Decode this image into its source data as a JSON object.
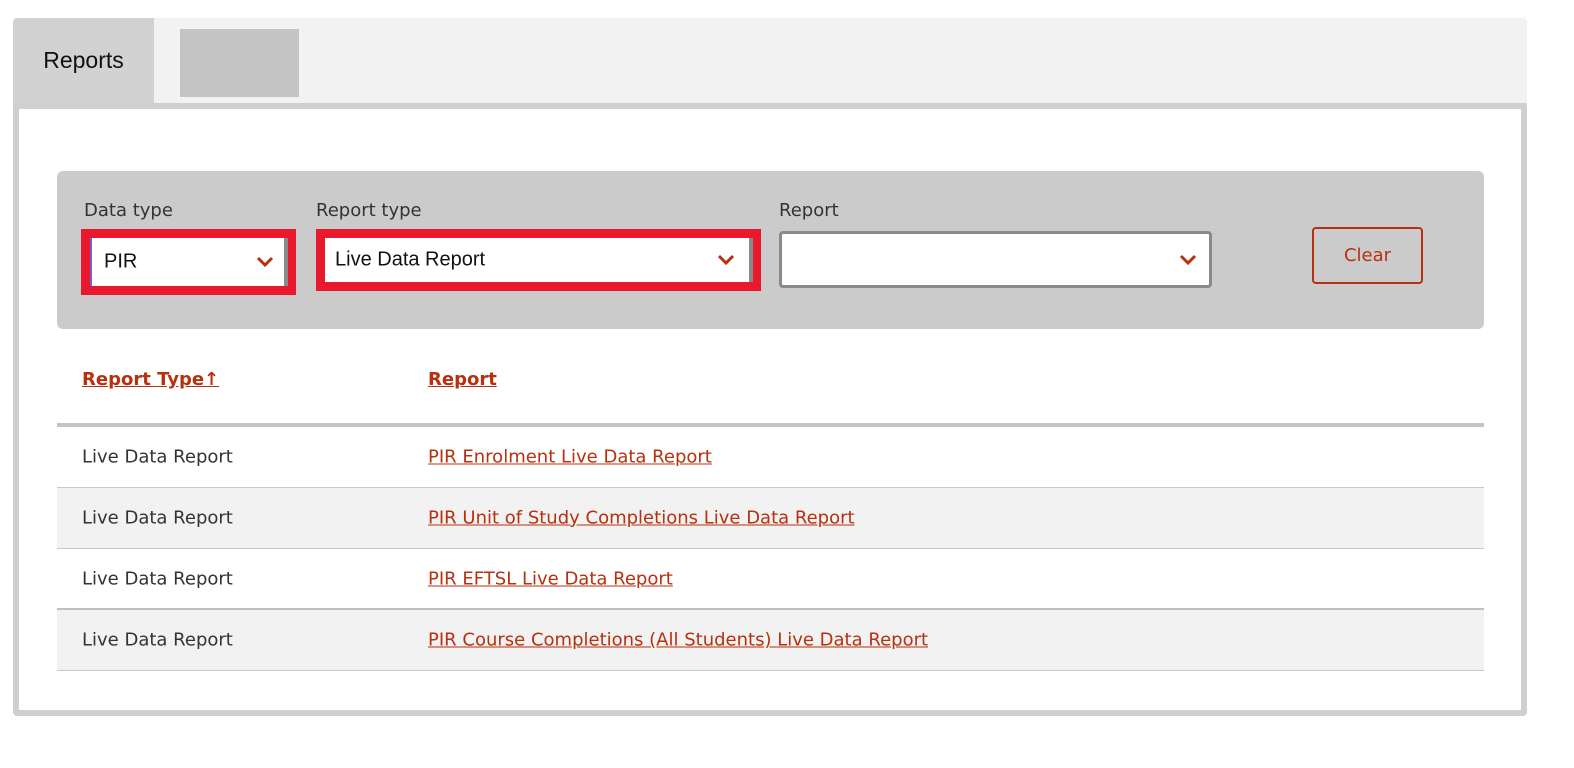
{
  "tabs": [
    {
      "label": "Reports"
    },
    {
      "label": ""
    }
  ],
  "filters": {
    "data_type": {
      "label": "Data type",
      "value": "PIR"
    },
    "report_type": {
      "label": "Report type",
      "value": "Live Data Report"
    },
    "report": {
      "label": "Report",
      "value": ""
    },
    "clear_label": "Clear"
  },
  "table": {
    "headers": {
      "report_type": "Report Type↑",
      "report": "Report"
    },
    "rows": [
      {
        "type": "Live Data Report",
        "report": "PIR Enrolment Live Data Report"
      },
      {
        "type": "Live Data Report",
        "report": "PIR Unit of Study Completions Live Data Report"
      },
      {
        "type": "Live Data Report",
        "report": "PIR EFTSL Live Data Report"
      },
      {
        "type": "Live Data Report",
        "report": "PIR Course Completions (All Students) Live Data Report"
      }
    ]
  },
  "colors": {
    "accent": "#b7300f",
    "highlight": "#e8192c",
    "filter_bg": "#cbcbcb"
  },
  "icons": {
    "dropdown": "chevron-down-icon"
  }
}
